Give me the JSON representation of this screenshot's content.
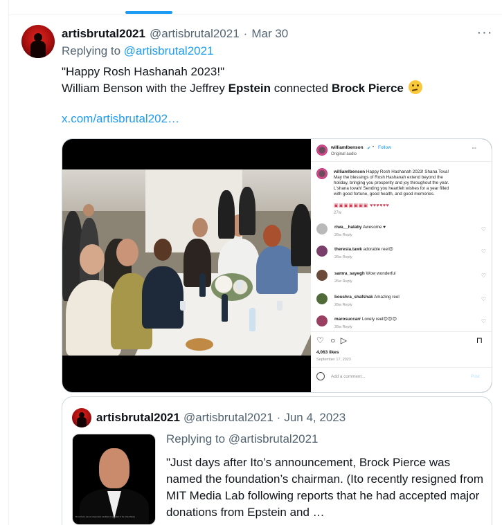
{
  "tweet": {
    "display_name": "artisbrutal2021",
    "handle": "@artisbrutal2021",
    "separator": "·",
    "date": "Mar 30",
    "more_icon": "ellipsis-icon",
    "replying_prefix": "Replying to",
    "replying_to": "@artisbrutal2021",
    "text_line1": "\"Happy Rosh Hashanah 2023!\"",
    "text_line2_a": "William Benson with the Jeffrey ",
    "text_line2_bold1": "Epstein",
    "text_line2_b": " connected ",
    "text_line2_bold2": "Brock Pierce",
    "emoji": "thinking-face-emoji",
    "link": "x.com/artisbrutal202…"
  },
  "media": {
    "ig_username": "williamlbenson",
    "ig_verified": "✔",
    "ig_dot": "•",
    "ig_follow": "Follow",
    "ig_audio": "Original audio",
    "ig_more": "···",
    "caption_user": "williamlbenson",
    "caption_text": "Happy Rosh Hashanah 2023! Shana Tova! May the blessings of Rosh Hashanah extend beyond the holiday, bringing you prosperity and joy throughout the year. L'shana tovah! Sending you heartfelt wishes for a year filled with good fortune, good health, and good memories.",
    "caption_hearts": "▣▣▣▣▣▣▣ ♥♥♥♥♥♥",
    "caption_age": "27w",
    "comments": [
      {
        "user": "riwa__halaby",
        "text": "Awesome ♥",
        "meta": "26w  Reply",
        "color": "#b9b9b9"
      },
      {
        "user": "theresia.tawk",
        "text": "adorable reel😍",
        "meta": "26w  Reply",
        "color": "#7a3e6a"
      },
      {
        "user": "samra_sayegh",
        "text": "Wow wonderful",
        "meta": "26w  Reply",
        "color": "#6b4a3a"
      },
      {
        "user": "boushra_shafshak",
        "text": "Amazing reel",
        "meta": "26w  Reply",
        "color": "#4f6b3a"
      },
      {
        "user": "marosuccarr",
        "text": "Lovely reel😍😍😍",
        "meta": "26w  Reply",
        "color": "#9a3f62"
      }
    ],
    "comment_heart": "♡",
    "actions": {
      "like": "♡",
      "comment": "○",
      "share": "▷",
      "save": "⊓"
    },
    "likes": "4,063 likes",
    "date": "September 17, 2023",
    "add_comment": "Add a comment...",
    "post": "Post"
  },
  "quote": {
    "display_name": "artisbrutal2021",
    "handle": "@artisbrutal2021",
    "separator": "·",
    "date": "Jun 4, 2023",
    "replying_prefix": "Replying to",
    "replying_to": "@artisbrutal2021",
    "text": "\"Just days after Ito’s announcement, Brock Pierce was named the foundation’s chairman. (Ito recently resigned from MIT Media Lab following reports that he had accepted major donations from Epstein and …",
    "thumb_caption": "Brock Pierce was an independent candidate for president of the United States."
  },
  "colors": {
    "accent": "#1d9bf0",
    "text": "#0f1419",
    "muted": "#536471",
    "border": "#cfd9de"
  }
}
